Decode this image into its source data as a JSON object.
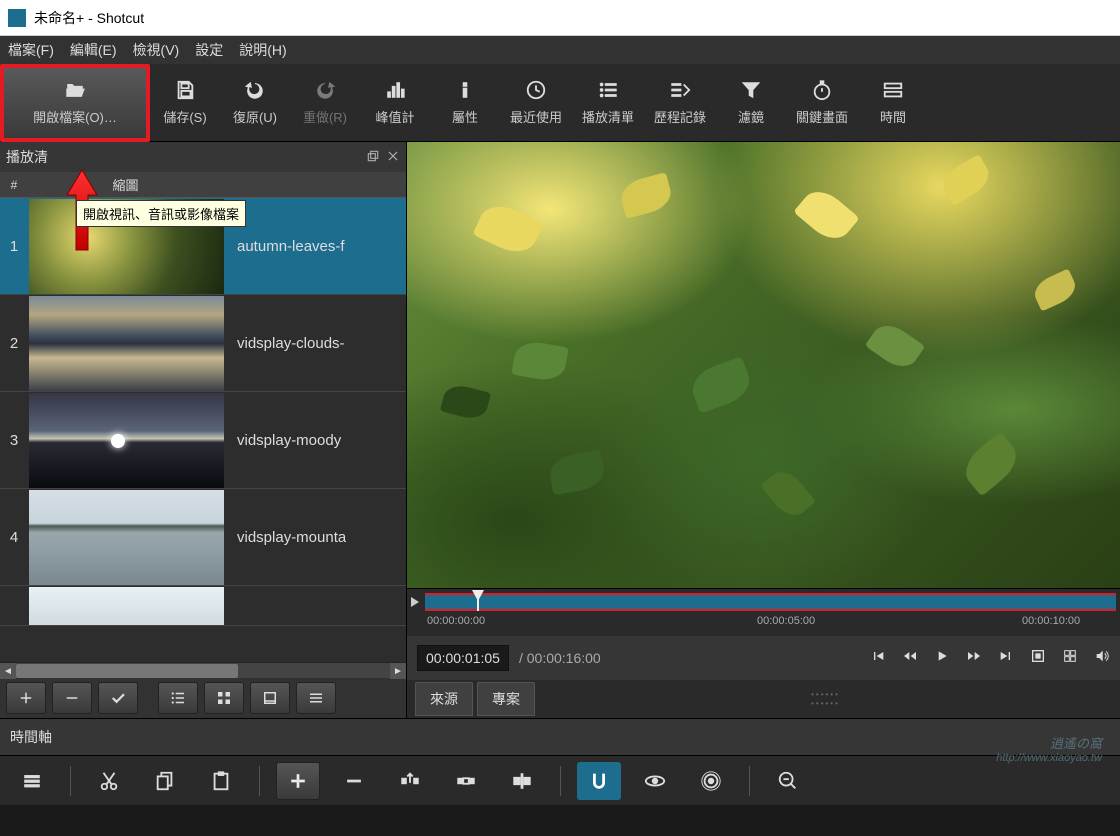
{
  "titlebar": {
    "title": "未命名+ - Shotcut"
  },
  "menubar": {
    "file": "檔案(F)",
    "edit": "編輯(E)",
    "view": "檢視(V)",
    "settings": "設定",
    "help": "說明(H)"
  },
  "toolbar": {
    "open": "開啟檔案(O)…",
    "save": "儲存(S)",
    "undo": "復原(U)",
    "redo": "重做(R)",
    "peak": "峰值計",
    "properties": "屬性",
    "recent": "最近使用",
    "playlist": "播放清單",
    "history": "歷程記錄",
    "filters": "濾鏡",
    "keyframes": "關鍵畫面",
    "timeline": "時間"
  },
  "tooltip": "開啟視訊、音訊或影像檔案",
  "leftPanel": {
    "title": "播放清",
    "colNum": "#",
    "colThumb": "縮圖",
    "items": [
      {
        "num": "1",
        "name": "autumn-leaves-f"
      },
      {
        "num": "2",
        "name": "vidsplay-clouds-"
      },
      {
        "num": "3",
        "name": "vidsplay-moody"
      },
      {
        "num": "4",
        "name": "vidsplay-mounta"
      }
    ]
  },
  "preview": {
    "currentTime": "00:00:01:05",
    "totalTime": "/ 00:00:16:00",
    "ticks": [
      "00:00:00:00",
      "00:00:05:00",
      "00:00:10:00"
    ]
  },
  "sourceTabs": {
    "source": "來源",
    "project": "專案"
  },
  "timeline": {
    "label": "時間軸"
  },
  "watermark": {
    "line1": "逍遙の窩",
    "line2": "http://www.xiaoyao.tw"
  }
}
